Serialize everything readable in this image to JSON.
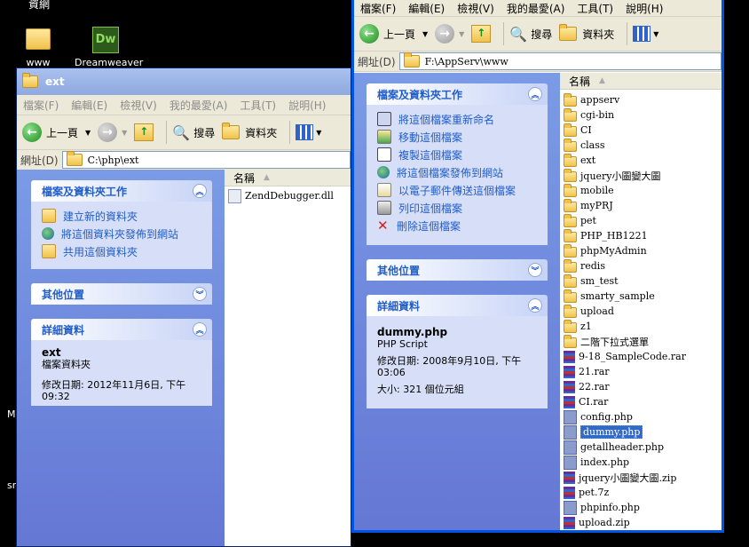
{
  "desktop": {
    "icons": [
      {
        "label": "www"
      },
      {
        "label": "Dreamweaver"
      }
    ],
    "top_label": "資網",
    "side_glyphs": [
      "M",
      "sr"
    ]
  },
  "left_window": {
    "title": "ext",
    "menu": [
      "檔案(F)",
      "編輯(E)",
      "檢視(V)",
      "我的最愛(A)",
      "工具(T)",
      "說明(H)"
    ],
    "toolbar": {
      "back": "上一頁",
      "search": "搜尋",
      "folders": "資料夾"
    },
    "address_label": "網址(D)",
    "address": "C:\\php\\ext",
    "tasks_header": "檔案及資料夾工作",
    "tasks": [
      "建立新的資料夾",
      "將這個資料夾發佈到網站",
      "共用這個資料夾"
    ],
    "other_header": "其他位置",
    "details_header": "詳細資料",
    "details": {
      "name": "ext",
      "type": "檔案資料夾",
      "modified": "修改日期: 2012年11月6日, 下午 09:32"
    },
    "column_name": "名稱",
    "files": [
      {
        "name": "ZendDebugger.dll",
        "kind": "dll"
      }
    ]
  },
  "right_window": {
    "menu": [
      "檔案(F)",
      "編輯(E)",
      "檢視(V)",
      "我的最愛(A)",
      "工具(T)",
      "說明(H)"
    ],
    "toolbar": {
      "back": "上一頁",
      "search": "搜尋",
      "folders": "資料夾"
    },
    "address_label": "網址(D)",
    "address": "F:\\AppServ\\www",
    "tasks_header": "檔案及資料夾工作",
    "tasks": [
      "將這個檔案重新命名",
      "移動這個檔案",
      "複製這個檔案",
      "將這個檔案發佈到網站",
      "以電子郵件傳送這個檔案",
      "列印這個檔案",
      "刪除這個檔案"
    ],
    "other_header": "其他位置",
    "details_header": "詳細資料",
    "details": {
      "name": "dummy.php",
      "type": "PHP Script",
      "modified": "修改日期: 2008年9月10日, 下午 03:06",
      "size": "大小: 321 個位元組"
    },
    "column_name": "名稱",
    "files": [
      {
        "name": "appserv",
        "kind": "folder"
      },
      {
        "name": "cgi-bin",
        "kind": "folder"
      },
      {
        "name": "CI",
        "kind": "folder"
      },
      {
        "name": "class",
        "kind": "folder"
      },
      {
        "name": "ext",
        "kind": "folder"
      },
      {
        "name": "jquery小圖變大圖",
        "kind": "folder"
      },
      {
        "name": "mobile",
        "kind": "folder"
      },
      {
        "name": "myPRJ",
        "kind": "folder"
      },
      {
        "name": "pet",
        "kind": "folder"
      },
      {
        "name": "PHP_HB1221",
        "kind": "folder"
      },
      {
        "name": "phpMyAdmin",
        "kind": "folder"
      },
      {
        "name": "redis",
        "kind": "folder"
      },
      {
        "name": "sm_test",
        "kind": "folder"
      },
      {
        "name": "smarty_sample",
        "kind": "folder"
      },
      {
        "name": "upload",
        "kind": "folder"
      },
      {
        "name": "z1",
        "kind": "folder"
      },
      {
        "name": "二階下拉式選單",
        "kind": "folder"
      },
      {
        "name": "9-18_SampleCode.rar",
        "kind": "rar"
      },
      {
        "name": "21.rar",
        "kind": "rar"
      },
      {
        "name": "22.rar",
        "kind": "rar"
      },
      {
        "name": "CI.rar",
        "kind": "rar"
      },
      {
        "name": "config.php",
        "kind": "php"
      },
      {
        "name": "dummy.php",
        "kind": "php",
        "selected": true
      },
      {
        "name": "getallheader.php",
        "kind": "php"
      },
      {
        "name": "index.php",
        "kind": "php"
      },
      {
        "name": "jquery小圖變大圖.zip",
        "kind": "rar"
      },
      {
        "name": "pet.7z",
        "kind": "rar"
      },
      {
        "name": "phpinfo.php",
        "kind": "php"
      },
      {
        "name": "upload.zip",
        "kind": "rar"
      }
    ]
  }
}
